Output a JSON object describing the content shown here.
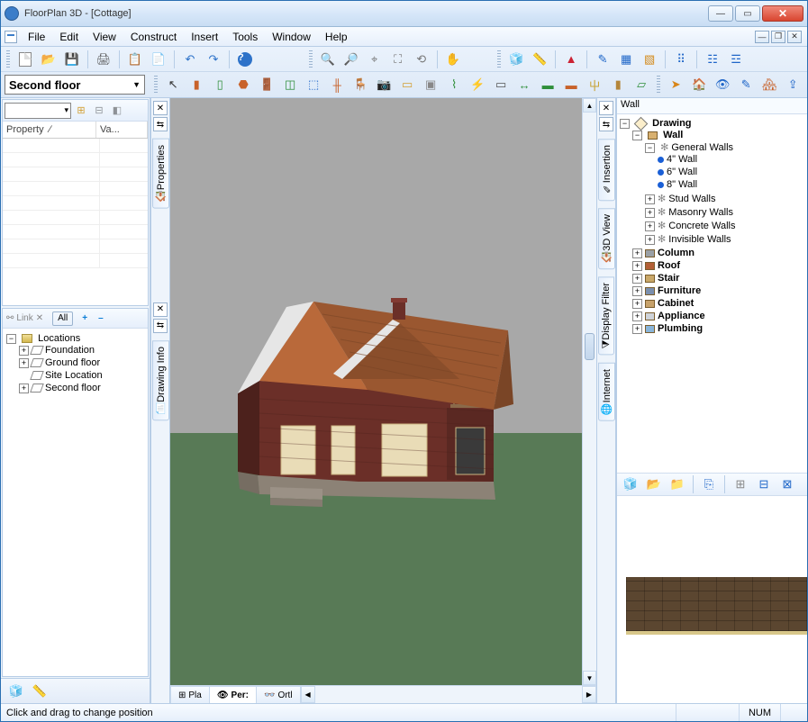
{
  "window": {
    "title": "FloorPlan 3D - [Cottage]"
  },
  "menus": [
    "File",
    "Edit",
    "View",
    "Construct",
    "Insert",
    "Tools",
    "Window",
    "Help"
  ],
  "floor_selector": {
    "value": "Second floor"
  },
  "properties_panel": {
    "col_property": "Property",
    "col_value": "Va..."
  },
  "locations_panel": {
    "link_label": "Link",
    "all_label": "All",
    "root": "Locations",
    "items": [
      "Foundation",
      "Ground floor",
      "Site Location",
      "Second floor"
    ]
  },
  "left_vtabs": [
    "Properties",
    "Drawing Info"
  ],
  "right_vtabs": [
    "Insertion",
    "3D View",
    "Display Filter",
    "Internet"
  ],
  "view_tabs": {
    "plan": "Pla",
    "pers": "Per:",
    "orth": "Ortl"
  },
  "right_panel": {
    "title": "Wall",
    "root": "Drawing",
    "wall": "Wall",
    "general_walls": "General Walls",
    "walls": [
      "4\" Wall",
      "6\" Wall",
      "8\" Wall"
    ],
    "wall_groups": [
      "Stud Walls",
      "Masonry Walls",
      "Concrete Walls",
      "Invisible Walls"
    ],
    "categories": [
      "Column",
      "Roof",
      "Stair",
      "Furniture",
      "Cabinet",
      "Appliance",
      "Plumbing"
    ]
  },
  "status": {
    "message": "Click and drag to change position",
    "num": "NUM"
  }
}
